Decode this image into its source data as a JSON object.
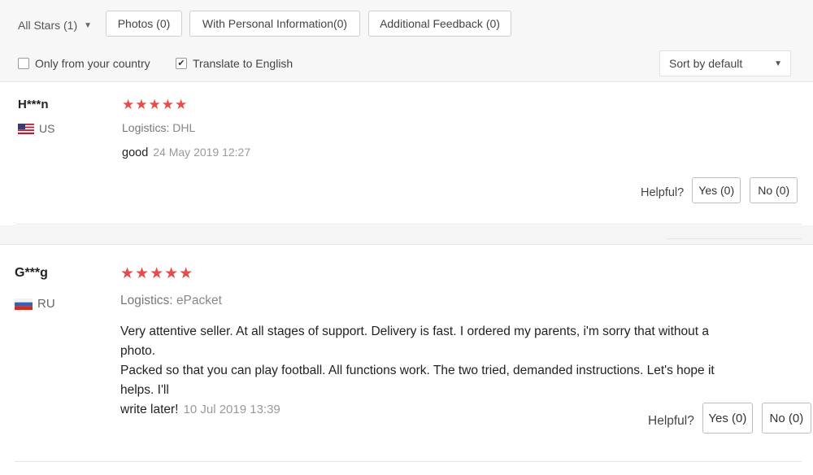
{
  "filters": {
    "all_stars": "All Stars (1)",
    "photos": "Photos (0)",
    "personal_info": "With Personal Information(0)",
    "additional_feedback": "Additional Feedback (0)"
  },
  "options": {
    "only_country": "Only from your country",
    "only_country_checked": false,
    "translate": "Translate to English",
    "translate_checked": true
  },
  "sort": {
    "selected": "Sort by default"
  },
  "reviews": [
    {
      "name": "H***n",
      "country": "US",
      "stars": "★★★★★",
      "rating": 5,
      "logistics_label": "Logistics:",
      "logistics_value": "DHL",
      "text": "good",
      "date": "24 May 2019 12:27",
      "helpful_label": "Helpful?",
      "yes": "Yes (0)",
      "no": "No (0)"
    },
    {
      "name": "G***g",
      "country": "RU",
      "stars": "★★★★★",
      "rating": 5,
      "logistics_label": "Logistics:",
      "logistics_value": "ePacket",
      "text_lines": [
        "Very attentive seller. At all stages of support. Delivery is fast. I ordered my parents, i'm sorry that without a photo.",
        "Packed so that you can play football. All functions work. The two tried, demanded instructions. Let's hope it helps. I'll",
        "write later!"
      ],
      "date": "10 Jul 2019 13:39",
      "helpful_label": "Helpful?",
      "yes": "Yes (0)",
      "no": "No (0)"
    }
  ],
  "colors": {
    "star": "#e74c4c",
    "topbar_bg": "#f7f7f7"
  }
}
